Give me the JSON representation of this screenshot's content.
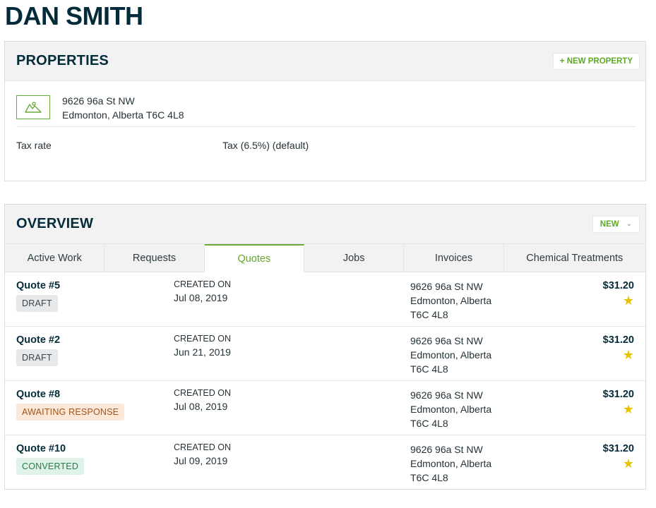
{
  "page": {
    "title": "DAN SMITH"
  },
  "properties": {
    "title": "PROPERTIES",
    "new_button": "+ NEW PROPERTY",
    "icon": "map-icon",
    "address_line1": "9626 96a St NW",
    "address_line2": "Edmonton, Alberta T6C 4L8",
    "tax_label": "Tax rate",
    "tax_value": "Tax (6.5%) (default)"
  },
  "overview": {
    "title": "OVERVIEW",
    "new_button": "NEW",
    "new_icon": "chevron-down-icon",
    "tabs": [
      "Active Work",
      "Requests",
      "Quotes",
      "Jobs",
      "Invoices",
      "Chemical Treatments"
    ],
    "active_tab": "Quotes",
    "quotes": [
      {
        "title": "Quote #5",
        "status": "DRAFT",
        "created_label": "CREATED ON",
        "created_date": "Jul 08, 2019",
        "addr1": "9626 96a St NW",
        "addr2": "Edmonton, Alberta",
        "addr3": "T6C 4L8",
        "amount": "$31.20"
      },
      {
        "title": "Quote #2",
        "status": "DRAFT",
        "created_label": "CREATED ON",
        "created_date": "Jun 21, 2019",
        "addr1": "9626 96a St NW",
        "addr2": "Edmonton, Alberta",
        "addr3": "T6C 4L8",
        "amount": "$31.20"
      },
      {
        "title": "Quote #8",
        "status": "AWAITING RESPONSE",
        "created_label": "CREATED ON",
        "created_date": "Jul 08, 2019",
        "addr1": "9626 96a St NW",
        "addr2": "Edmonton, Alberta",
        "addr3": "T6C 4L8",
        "amount": "$31.20"
      },
      {
        "title": "Quote #10",
        "status": "CONVERTED",
        "created_label": "CREATED ON",
        "created_date": "Jul 09, 2019",
        "addr1": "9626 96a St NW",
        "addr2": "Edmonton, Alberta",
        "addr3": "T6C 4L8",
        "amount": "$31.20"
      }
    ]
  },
  "colors": {
    "brand_dark": "#032b3a",
    "accent_green": "#5ea825",
    "star": "#e8c300"
  }
}
